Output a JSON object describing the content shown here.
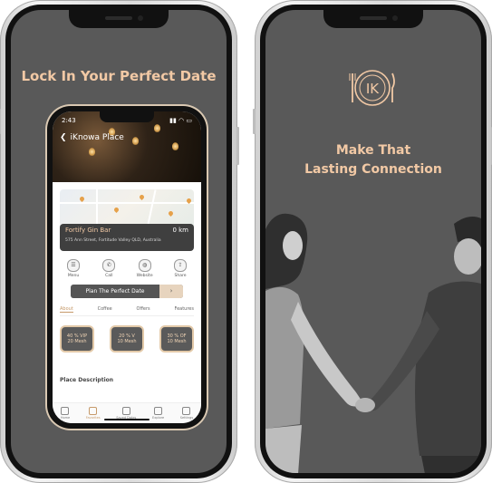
{
  "left_phone": {
    "headline": "Lock In Your Perfect Date",
    "app": {
      "time": "2:43",
      "status_icons": "▮▮ ◠ ▭",
      "back_title": "iKnowa Place",
      "venue": {
        "name": "Fortify Gin Bar",
        "distance": "0 km",
        "address": "575 Ann Street, Fortitude Valley QLD, Australia"
      },
      "actions": [
        {
          "label": "Menu",
          "icon": "menu-icon"
        },
        {
          "label": "Call",
          "icon": "phone-icon"
        },
        {
          "label": "Website",
          "icon": "globe-icon"
        },
        {
          "label": "Share",
          "icon": "share-icon"
        }
      ],
      "plan_button": "Plan The Perfect Date",
      "plan_arrow": "›",
      "tabs": [
        "About",
        "Coffee",
        "Offers",
        "Features"
      ],
      "offers": [
        {
          "line1": "40 % VIP",
          "line2": "20 Mesh"
        },
        {
          "line1": "20 % V",
          "line2": "10 Mesh"
        },
        {
          "line1": "30 % OF",
          "line2": "10 Mesh"
        }
      ],
      "section_title": "Place Description",
      "bottom_nav": [
        "Home",
        "Favorites",
        "Saved Dates",
        "Explore",
        "Settings"
      ]
    }
  },
  "right_phone": {
    "logo_text": "IK",
    "tagline_line1": "Make That",
    "tagline_line2": "Lasting Connection"
  },
  "colors": {
    "screen_bg": "#595959",
    "accent": "#f2c9a5",
    "accent_dark": "#c69a6a"
  }
}
